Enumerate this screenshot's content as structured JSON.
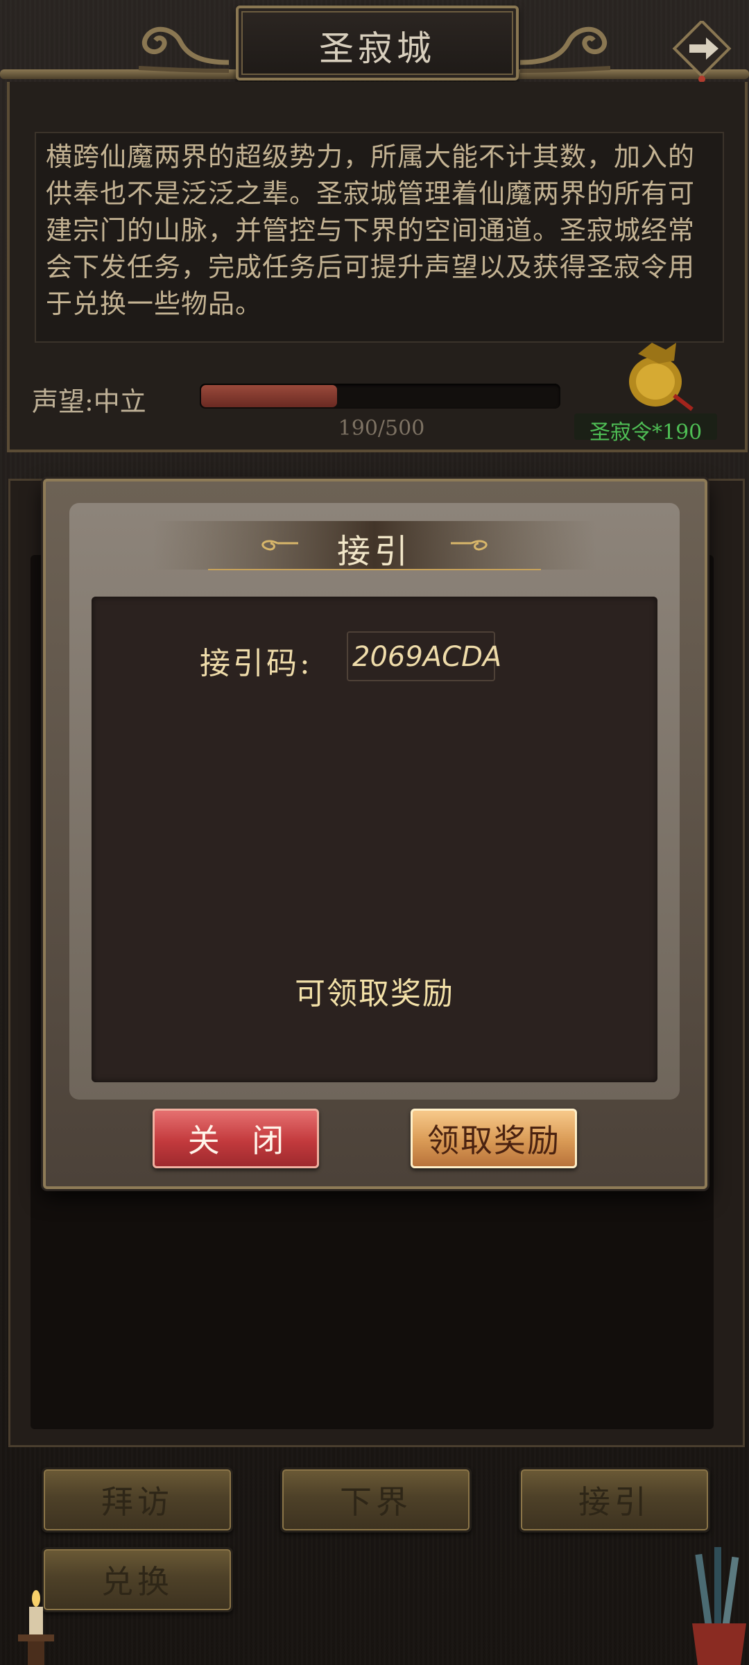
{
  "header": {
    "title": "圣寂城"
  },
  "info": {
    "description": "横跨仙魔两界的超级势力，所属大能不计其数，加入的供奉也不是泛泛之辈。圣寂城管理着仙魔两界的所有可建宗门的山脉，并管控与下界的空间通道。圣寂城经常会下发任务，完成任务后可提升声望以及获得圣寂令用于兑换一些物品。",
    "reputation_label": "声望:中立",
    "reputation_current": 190,
    "reputation_max": 500,
    "reputation_text": "190/500",
    "token_text": "圣寂令*190"
  },
  "modal": {
    "title": "接引",
    "code_label": "接引码:",
    "code_value": "2069ACDA",
    "hint": "可领取奖励",
    "close_label": "关 闭",
    "claim_label": "领取奖励"
  },
  "tabs": [
    {
      "label": "拜访"
    },
    {
      "label": "下界"
    },
    {
      "label": "接引"
    },
    {
      "label": "兑换"
    }
  ],
  "colors": {
    "accent_gold": "#efdcaa",
    "token_green": "#4fbf55",
    "bar_red": "#9a4a3b"
  }
}
